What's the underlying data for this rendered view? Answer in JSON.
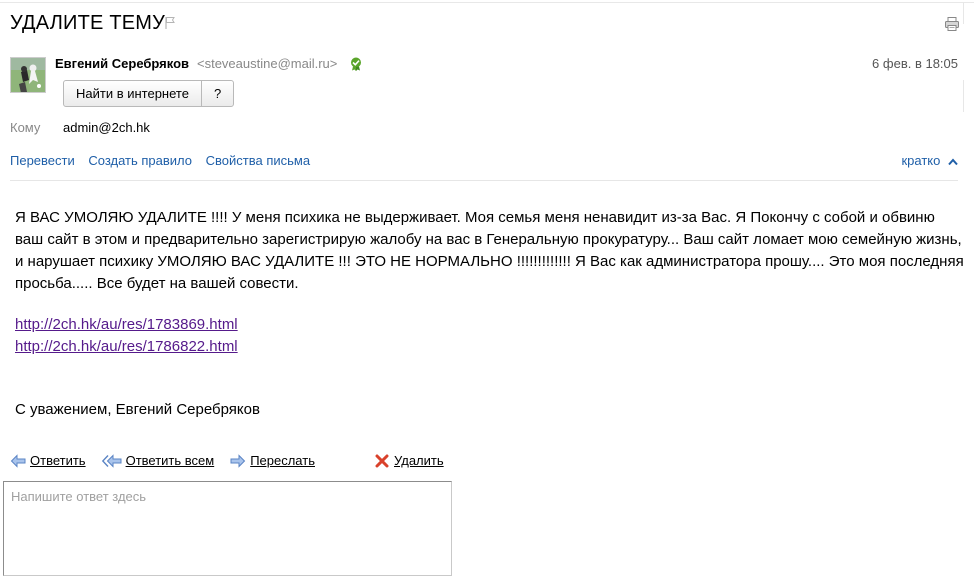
{
  "message": {
    "subject": "УДАЛИТЕ ТЕМУ",
    "sender_name": "Евгений Серебряков",
    "sender_email": "<steveaustine@mail.ru>",
    "date": "6 фев. в 18:05",
    "to_label": "Кому",
    "to_value": "admin@2ch.hk"
  },
  "buttons": {
    "search_web": "Найти в интернете",
    "help": "?"
  },
  "actions": {
    "translate": "Перевести",
    "create_rule": "Создать правило",
    "properties": "Свойства письма",
    "brief": "кратко"
  },
  "body": {
    "paragraph": "Я ВАС УМОЛЯЮ УДАЛИТЕ !!!! У меня психика не выдерживает. Моя семья меня ненавидит из-за Вас. Я Покончу с собой и обвиню ваш сайт в этом и предварительно зарегистрирую жалобу на вас в Генеральную  прокуратуру... Ваш сайт ломает мою семейную жизнь, и нарушает психику   УМОЛЯЮ ВАС УДАЛИТЕ !!! ЭТО НЕ НОРМАЛЬНО !!!!!!!!!!!!! Я Вас как администратора прошу.... Это моя последняя просьба..... Все будет на вашей совести.",
    "links": [
      "http://2ch.hk/au/res/1783869.html",
      "http://2ch.hk/au/res/1786822.html"
    ],
    "signature": "С уважением, Евгений Серебряков"
  },
  "reply": {
    "reply_label": "Ответить",
    "reply_all_label": "Ответить всем",
    "forward_label": "Переслать",
    "delete_label": "Удалить",
    "placeholder": "Напишите ответ здесь"
  },
  "icons": {
    "flag": "flag-icon",
    "print": "printer-icon",
    "verified": "verified-badge-icon",
    "reply": "reply-arrow-icon",
    "reply_all": "reply-all-arrow-icon",
    "forward": "forward-arrow-icon",
    "delete": "red-cross-icon",
    "chevron": "chevron-up-icon"
  },
  "colors": {
    "link_blue": "#1f5fa8",
    "visited_link": "#551a8b",
    "verified_green": "#5aa52a",
    "delete_red": "#d9412b"
  }
}
